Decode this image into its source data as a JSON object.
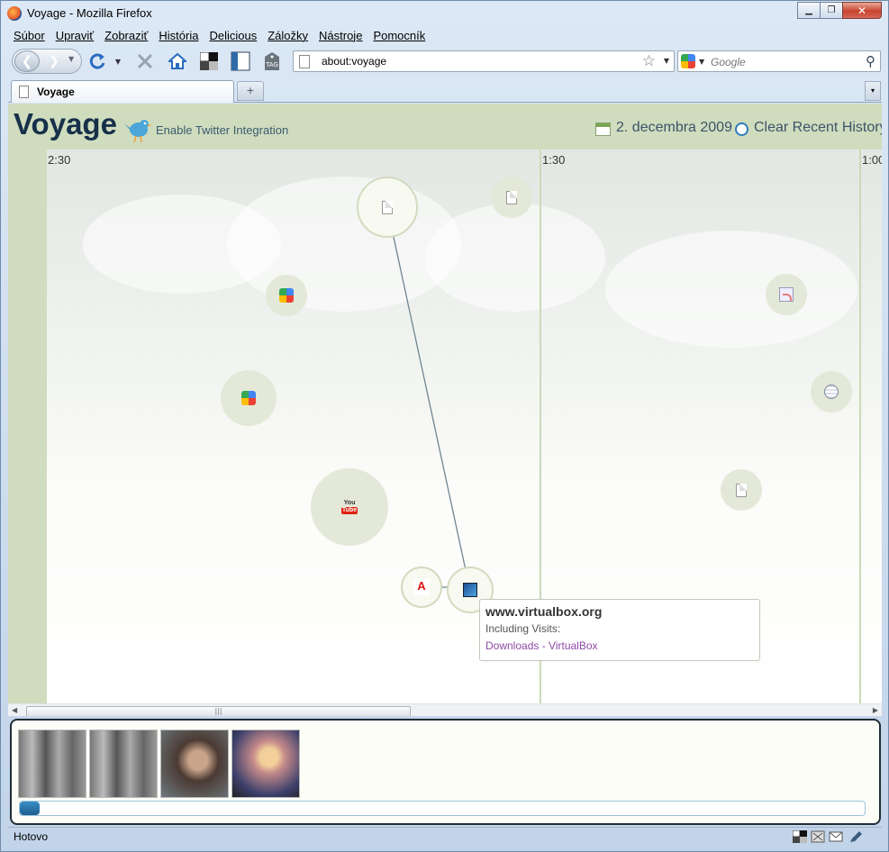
{
  "window": {
    "title": "Voyage - Mozilla Firefox",
    "controls": {
      "minimize": "▁",
      "maximize": "❐",
      "close": "✕"
    }
  },
  "menu": [
    "Súbor",
    "Upraviť",
    "Zobraziť",
    "História",
    "Delicious",
    "Záložky",
    "Nástroje",
    "Pomocník"
  ],
  "navbar": {
    "url": "about:voyage",
    "search_placeholder": "Google",
    "icons": [
      "back-icon",
      "forward-icon",
      "reload-icon",
      "stop-icon",
      "home-icon",
      "delicious-icon",
      "bookmarks-sidebar-icon",
      "tag-icon"
    ]
  },
  "tabs": {
    "items": [
      {
        "label": "Voyage",
        "active": true
      }
    ],
    "new_tab": "+",
    "list_all": "▾"
  },
  "voyage": {
    "title": "Voyage",
    "twitter_link": "Enable Twitter Integration",
    "date": "2. decembra 2009",
    "clear_history": "Clear Recent History",
    "time_labels": [
      "2:30",
      "1:30",
      "1:00"
    ],
    "nodes": [
      {
        "icon": "page-icon",
        "size": "large",
        "outlined": true
      },
      {
        "icon": "page-icon",
        "size": "small"
      },
      {
        "icon": "google-icon",
        "size": "small"
      },
      {
        "icon": "google-icon",
        "size": "medium"
      },
      {
        "icon": "youtube-icon",
        "size": "large"
      },
      {
        "icon": "adobe-icon",
        "size": "small",
        "outlined": true
      },
      {
        "icon": "virtualbox-icon",
        "size": "small",
        "outlined": true
      },
      {
        "icon": "rss-icon",
        "size": "small"
      },
      {
        "icon": "globe-icon",
        "size": "small"
      },
      {
        "icon": "page-icon",
        "size": "small"
      }
    ],
    "tooltip": {
      "domain": "www.virtualbox.org",
      "including_label": "Including Visits:",
      "visits": [
        "Downloads - VirtualBox"
      ]
    },
    "accent_colors": {
      "header_bg": "#cfdcbe",
      "title": "#17304a",
      "link_visited": "#8e49a6"
    }
  },
  "media_panel": {
    "thumbnails": [
      "video-thumbnail-1",
      "video-thumbnail-2",
      "video-thumbnail-3",
      "video-thumbnail-4"
    ],
    "progress": 0.02
  },
  "statusbar": {
    "text": "Hotovo",
    "icons": [
      "delicious-status-icon",
      "addon-status-icon",
      "mail-status-icon",
      "pen-status-icon"
    ]
  }
}
